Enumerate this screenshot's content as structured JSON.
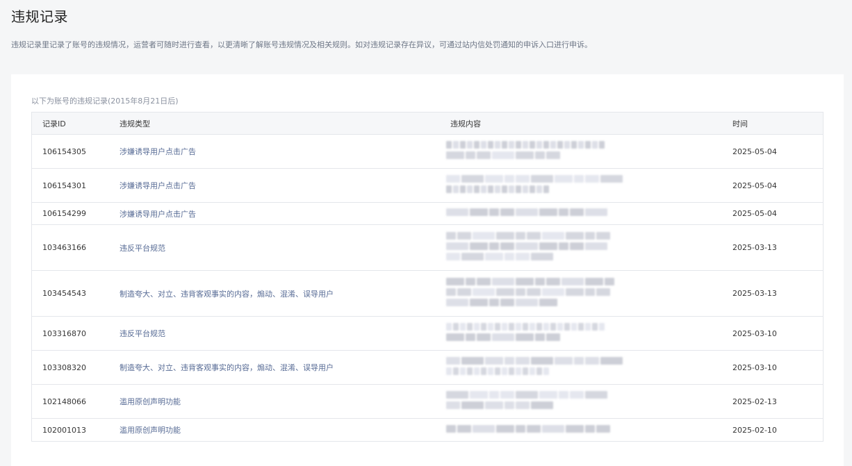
{
  "header": {
    "title": "违规记录",
    "description": "违规记录里记录了账号的违规情况，运营者可随时进行查看，以更清晰了解账号违规情况及相关规则。如对违规记录存在异议，可通过站内信处罚通知的申诉入口进行申诉。"
  },
  "table": {
    "caption": "以下为账号的违规记录(2015年8月21日后)",
    "columns": {
      "id": "记录ID",
      "type": "违规类型",
      "content": "违规内容",
      "time": "时间"
    },
    "rows": [
      {
        "id": "106154305",
        "type": "涉嫌诱导用户点击广告",
        "time": "2025-05-04"
      },
      {
        "id": "106154301",
        "type": "涉嫌诱导用户点击广告",
        "time": "2025-05-04"
      },
      {
        "id": "106154299",
        "type": "涉嫌诱导用户点击广告",
        "time": "2025-05-04"
      },
      {
        "id": "103463166",
        "type": "违反平台规范",
        "time": "2025-03-13"
      },
      {
        "id": "103454543",
        "type": "制造夸大、对立、违背客观事实的内容，煽动、混淆、误导用户",
        "time": "2025-03-13"
      },
      {
        "id": "103316870",
        "type": "违反平台规范",
        "time": "2025-03-10"
      },
      {
        "id": "103308320",
        "type": "制造夸大、对立、违背客观事实的内容，煽动、混淆、误导用户",
        "time": "2025-03-10"
      },
      {
        "id": "102148066",
        "type": "滥用原创声明功能",
        "time": "2025-02-13"
      },
      {
        "id": "102001013",
        "type": "滥用原创声明功能",
        "time": "2025-02-10"
      }
    ]
  }
}
